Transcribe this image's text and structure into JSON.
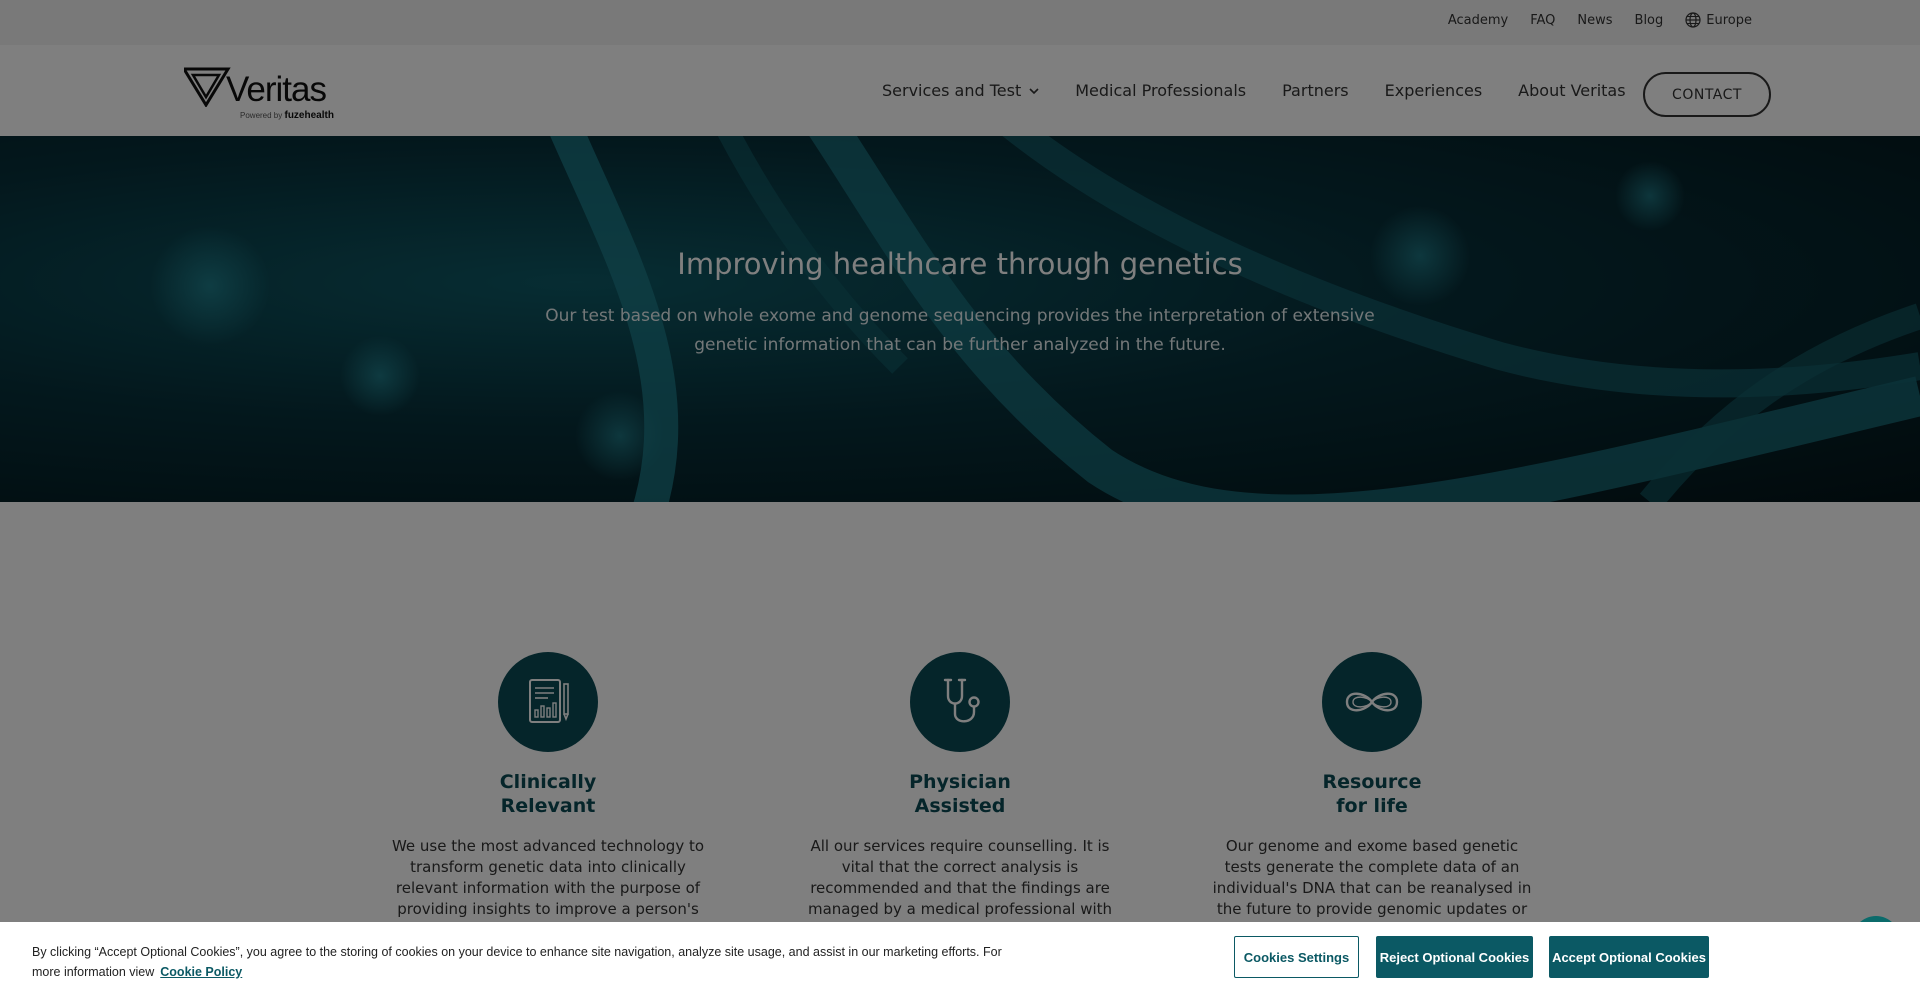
{
  "utility_nav": {
    "links": [
      "Academy",
      "FAQ",
      "News",
      "Blog"
    ],
    "region": "Europe"
  },
  "brand": {
    "name": "Veritas",
    "powered_by": "Powered by",
    "parent": "fuzehealth"
  },
  "main_nav": {
    "services": "Services and Test",
    "medical_professionals": "Medical Professionals",
    "partners": "Partners",
    "experiences": "Experiences",
    "about": "About Veritas",
    "contact": "CONTACT"
  },
  "hero": {
    "title": "Improving healthcare through genetics",
    "subtitle": "Our test based on whole exome and genome sequencing provides the interpretation of extensive genetic information that can be further analyzed in the future."
  },
  "features": [
    {
      "icon": "report-chart-icon",
      "title_line1": "Clinically",
      "title_line2": "Relevant",
      "text": "We use the most advanced technology to transform genetic data into clinically relevant information with the purpose of providing insights to improve a person's quality and"
    },
    {
      "icon": "stethoscope-icon",
      "title_line1": "Physician",
      "title_line2": "Assisted",
      "text": "All our services require counselling. It is vital that the correct analysis is recommended and that the findings are managed by a medical professional with expertise in genetics."
    },
    {
      "icon": "infinity-dna-icon",
      "title_line1": "Resource",
      "title_line2": "for life",
      "text": "Our genome and exome based genetic tests generate the complete data of an individual's DNA that can be reanalysed in the future to provide genomic updates or targeted studies as"
    }
  ],
  "cookie_banner": {
    "text": "By clicking “Accept Optional Cookies”, you agree to the storing of cookies on your device to enhance site navigation, analyze site usage, and assist in our marketing efforts. For more information view",
    "policy_link": "Cookie Policy",
    "settings_button": "Cookies Settings",
    "reject_button": "Reject Optional Cookies",
    "accept_button": "Accept Optional Cookies"
  },
  "colors": {
    "brand_teal": "#0b4a55",
    "button_teal": "#0b5964"
  }
}
